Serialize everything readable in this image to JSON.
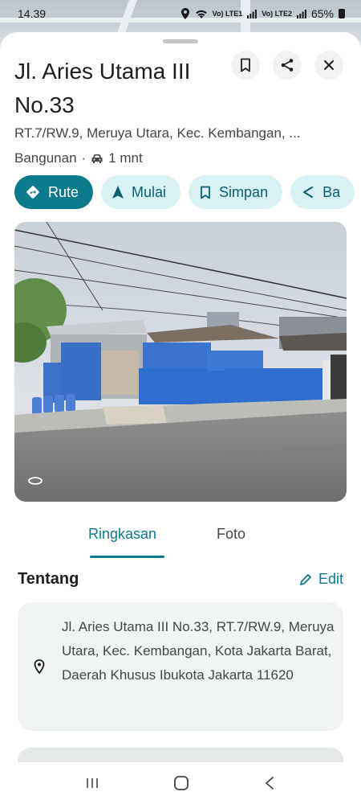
{
  "status": {
    "time": "14.39",
    "sim1": "Vo) LTE1",
    "sim2": "Vo) LTE2",
    "battery": "65%"
  },
  "place": {
    "title": "Jl. Aries Utama III No.33",
    "subtitle": "RT.7/RW.9, Meruya Utara, Kec. Kembangan, ...",
    "category": "Bangunan",
    "separator": "·",
    "drive_time": "1 mnt"
  },
  "actions": [
    {
      "label": "Rute",
      "icon": "directions-icon"
    },
    {
      "label": "Mulai",
      "icon": "navigation-arrow-icon"
    },
    {
      "label": "Simpan",
      "icon": "bookmark-icon"
    },
    {
      "label": "Ba",
      "icon": "share-icon"
    }
  ],
  "tabs": [
    {
      "label": "Ringkasan",
      "active": true
    },
    {
      "label": "Foto",
      "active": false
    }
  ],
  "about": {
    "title": "Tentang",
    "edit_label": "Edit",
    "address": "Jl. Aries Utama III No.33, RT.7/RW.9, Meruya Utara, Kec. Kembangan, Kota Jakarta Barat, Daerah Khusus Ibukota Jakarta 11620"
  },
  "colors": {
    "accent": "#0b7a8a",
    "chip_bg": "#d8f1f5",
    "card_bg": "#f1f4f5",
    "building_blue": "#2f6fd0"
  }
}
